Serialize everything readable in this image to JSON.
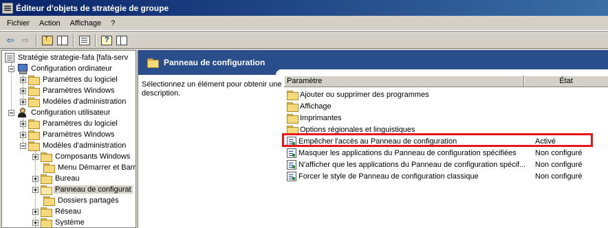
{
  "window": {
    "title": "Éditeur d'objets de stratégie de groupe"
  },
  "menu": [
    "Fichier",
    "Action",
    "Affichage",
    "?"
  ],
  "toolbar": {
    "back_icon": "back-arrow-icon",
    "forward_icon": "forward-arrow-icon"
  },
  "tree": {
    "root": "Stratégie strategie-fafa [fafa-serv",
    "computer_config": "Configuration ordinateur",
    "computer_children": [
      "Paramètres du logiciel",
      "Paramètres Windows",
      "Modèles d'administration"
    ],
    "user_config": "Configuration utilisateur",
    "user_children": [
      "Paramètres du logiciel",
      "Paramètres Windows",
      "Modèles d'administration"
    ],
    "admin_templates_children": [
      "Composants Windows",
      "Menu Démarrer et Barr",
      "Bureau",
      "Panneau de configurat",
      "Dossiers partagés",
      "Réseau",
      "Système"
    ]
  },
  "details": {
    "header_title": "Panneau de configuration",
    "description": "Sélectionnez un élément pour obtenir une description.",
    "columns": {
      "param": "Paramètre",
      "state": "État"
    },
    "folders": [
      "Ajouter ou supprimer des programmes",
      "Affichage",
      "Imprimantes",
      "Options régionales et linguistiques"
    ],
    "settings": [
      {
        "name": "Empêcher l'accès au Panneau de configuration",
        "state": "Activé"
      },
      {
        "name": "Masquer les applications du Panneau de configuration spécifiées",
        "state": "Non configuré"
      },
      {
        "name": "N'afficher que les applications du Panneau de configuration spécif...",
        "state": "Non configuré"
      },
      {
        "name": "Forcer le style de Panneau de configuration classique",
        "state": "Non configuré"
      }
    ]
  },
  "colors": {
    "title_bar": "#0a246a",
    "header_band": "#2a4d8c",
    "highlight_box": "#e8161c"
  }
}
